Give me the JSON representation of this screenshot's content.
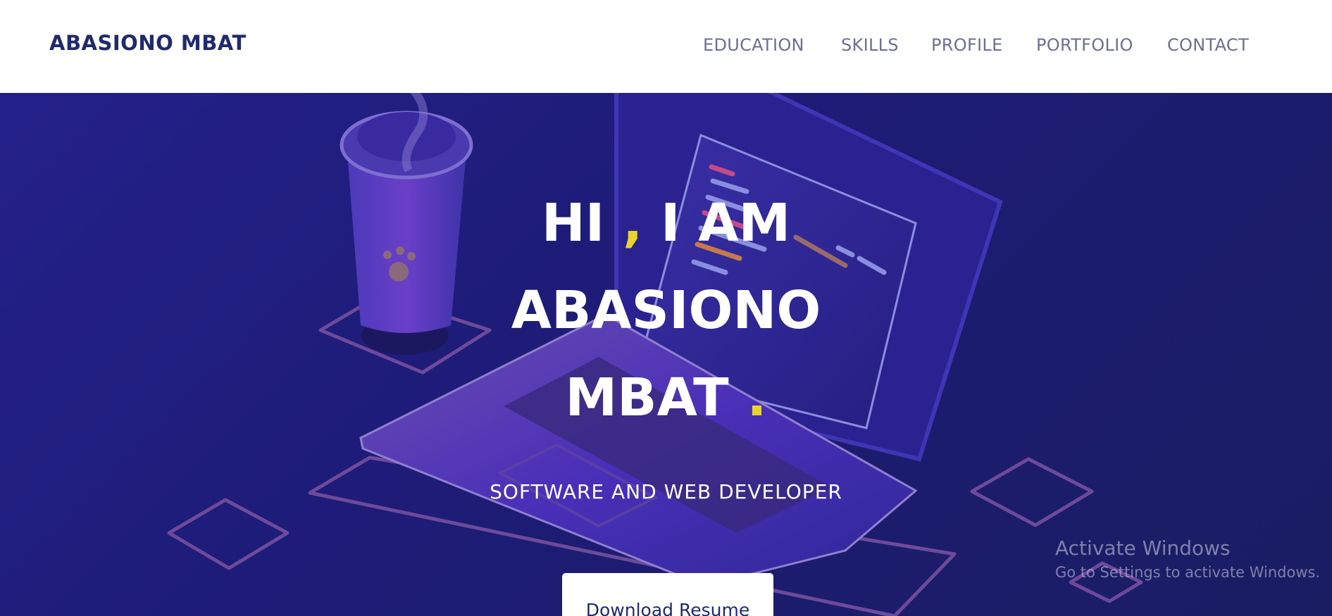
{
  "header": {
    "brand": "ABASIONO MBAT",
    "nav": [
      "EDUCATION",
      "SKILLS",
      "PROFILE",
      "PORTFOLIO",
      "CONTACT"
    ]
  },
  "hero": {
    "line1_a": "HI",
    "line1_comma": ",",
    "line1_b": "I AM",
    "line2": "ABASIONO",
    "line3": "MBAT",
    "line3_dot": ".",
    "subtitle": "SOFTWARE AND WEB DEVELOPER",
    "button": "Download Resume"
  },
  "watermark": {
    "title": "Activate Windows",
    "subtitle": "Go to Settings to activate Windows."
  },
  "colors": {
    "brand": "#1f2a6e",
    "hero_background": "#1e1c78",
    "accent_yellow": "#e7d52c"
  }
}
